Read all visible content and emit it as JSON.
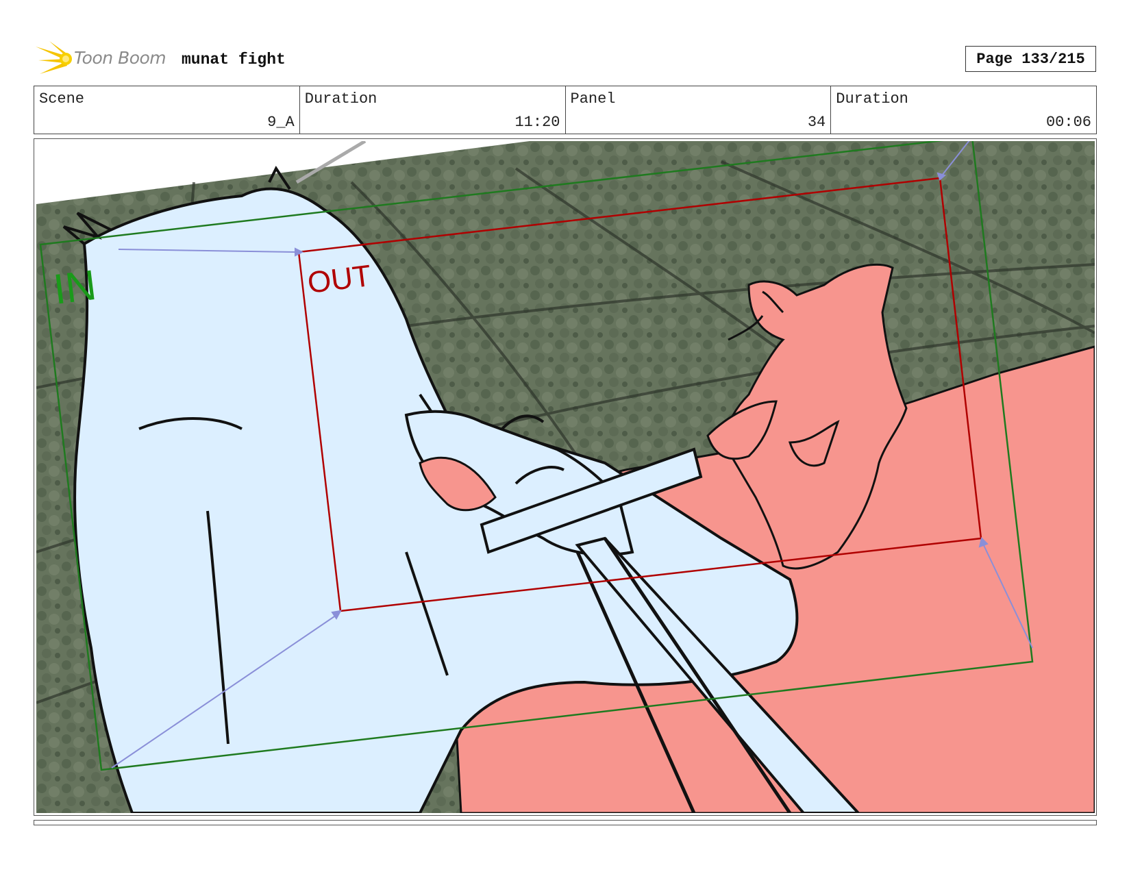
{
  "header": {
    "logo_text": "Toon Boom",
    "project_title": "munat fight",
    "page_label": "Page 133/215"
  },
  "info": {
    "scene_label": "Scene",
    "scene_value": "9_A",
    "scene_duration_label": "Duration",
    "scene_duration_value": "11:20",
    "panel_label": "Panel",
    "panel_value": "34",
    "panel_duration_label": "Duration",
    "panel_duration_value": "00:06"
  },
  "panel": {
    "in_label": "IN",
    "out_label": "OUT"
  },
  "colors": {
    "in_frame": "#1f7a1f",
    "out_frame": "#b00000",
    "foreground_character": "#dcefff",
    "background_character": "#f7958e",
    "terrain": "#6b7a62"
  }
}
